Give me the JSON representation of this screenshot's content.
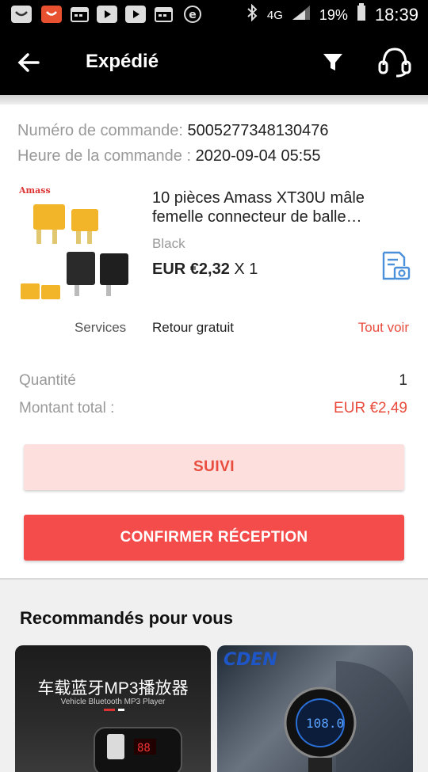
{
  "status_bar": {
    "network": "4G",
    "battery": "19%",
    "time": "18:39"
  },
  "app_bar": {
    "title": "Expédié"
  },
  "order": {
    "number_label": "Numéro de commande:",
    "number_value": "5005277348130476",
    "time_label": "Heure de la commande :",
    "time_value": "2020-09-04 05:55"
  },
  "product": {
    "brand_label": "Amass",
    "name": "10 pièces Amass XT30U mâle femelle connecteur de balle…",
    "variant": "Black",
    "price": "EUR €2,32",
    "quantity_text": "X 1"
  },
  "services": {
    "label": "Services",
    "value": "Retour gratuit",
    "see_all": "Tout voir"
  },
  "summary": {
    "quantity_label": "Quantité",
    "quantity_value": "1",
    "total_label": "Montant total :",
    "total_value": "EUR €2,49"
  },
  "buttons": {
    "track": "SUIVI",
    "confirm": "CONFIRMER RÉCEPTION"
  },
  "recommendations": {
    "title": "Recommandés pour vous",
    "items": [
      {
        "headline": "车载蓝牙MP3播放器",
        "subline": "Vehicle Bluetooth MP3 Player"
      },
      {
        "headline": "CDEN"
      }
    ]
  },
  "colors": {
    "accent_red": "#e94c3d",
    "confirm_button": "#f44b4b",
    "track_button_bg": "#fde0dd",
    "snapshot_icon_blue": "#4a8fd9"
  }
}
